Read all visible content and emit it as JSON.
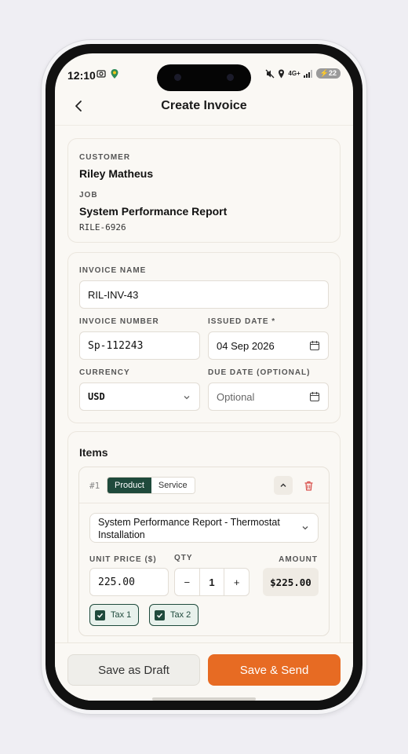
{
  "status": {
    "time": "12:10",
    "network": "4G+",
    "battery": "22"
  },
  "nav": {
    "title": "Create Invoice"
  },
  "customer_card": {
    "customer_label": "CUSTOMER",
    "customer_name": "Riley Matheus",
    "job_label": "JOB",
    "job_name": "System Performance Report",
    "job_code": "RILE-6926"
  },
  "invoice_form": {
    "name_label": "INVOICE NAME",
    "name_value": "RIL-INV-43",
    "number_label": "INVOICE NUMBER",
    "number_value": "Sp-112243",
    "issued_label": "ISSUED DATE *",
    "issued_value": "04 Sep 2026",
    "currency_label": "CURRENCY",
    "currency_value": "USD",
    "due_label": "DUE DATE (OPTIONAL)",
    "due_placeholder": "Optional"
  },
  "items": {
    "title": "Items",
    "item": {
      "index": "#1",
      "type_product": "Product",
      "type_service": "Service",
      "selected_type": "Product",
      "description": "System Performance Report - Thermostat Installation",
      "unit_price_label": "UNIT PRICE ($)",
      "unit_price": "225.00",
      "qty_label": "QTY",
      "qty": "1",
      "qty_minus": "−",
      "qty_plus": "+",
      "amount_label": "AMOUNT",
      "amount": "$225.00",
      "taxes": [
        {
          "label": "Tax 1",
          "checked": true
        },
        {
          "label": "Tax 2",
          "checked": true
        }
      ]
    }
  },
  "actions": {
    "draft": "Save as Draft",
    "send": "Save & Send"
  },
  "colors": {
    "accent_green": "#1f4a3c",
    "primary_orange": "#e76b23",
    "delete_red": "#d9534f"
  }
}
